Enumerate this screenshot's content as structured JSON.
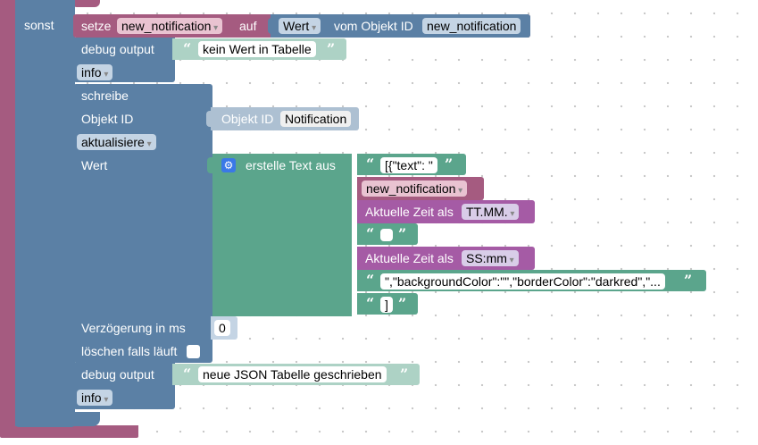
{
  "else_label": "sonst",
  "set_block": {
    "prefix": "setze",
    "variable": "new_notification",
    "middle": "auf",
    "value_field": "Wert",
    "object_label": "vom Objekt ID",
    "object_id": "new_notification"
  },
  "debug1": {
    "label": "debug output",
    "text": "kein Wert in Tabelle",
    "level": "info"
  },
  "write_block": {
    "title": "schreibe",
    "object_id_label": "Objekt ID",
    "object_id_block_label": "Objekt ID",
    "object_id_value": "Notification",
    "mode": "aktualisiere",
    "value_label": "Wert",
    "create_text_label": "erstelle Text aus",
    "parts": {
      "text1": "[{\"text\": \"",
      "var": "new_notification",
      "time1_label": "Aktuelle Zeit als",
      "time1_format": "TT.MM.",
      "text2": "",
      "time2_label": "Aktuelle Zeit als",
      "time2_format": "SS:mm",
      "text3": "\",\"backgroundColor\":\"\",\"borderColor\":\"darkred\",\"...",
      "text4": "]"
    },
    "delay_label": "Verzögerung in ms",
    "delay_value": "0",
    "clear_label": "löschen falls läuft"
  },
  "debug2": {
    "label": "debug output",
    "text": "neue JSON Tabelle geschrieben",
    "level": "info"
  },
  "colors": {
    "control": "#a55b80",
    "script": "#5b80a5",
    "text": "#5ba58c",
    "text_light": "#add2c5",
    "object_light": "#adc0d2",
    "variable": "#a55b80",
    "time": "#a55ba5",
    "canvas": "#ffffff"
  }
}
